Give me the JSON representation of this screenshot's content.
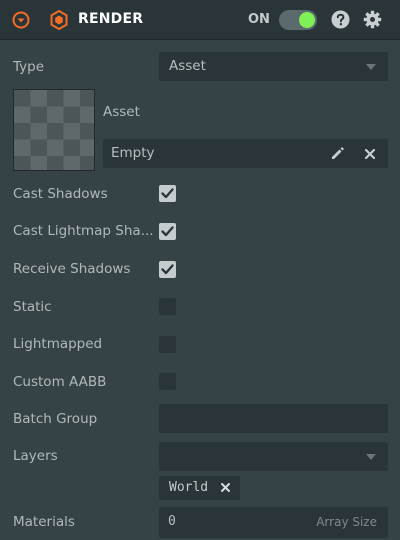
{
  "header": {
    "title": "RENDER",
    "enabled_label": "ON",
    "enabled": true,
    "accent_color": "#f66d25",
    "toggle_on_color": "#7ff057",
    "icons": [
      "collapse-icon",
      "render-component-icon",
      "help-icon",
      "gear-icon"
    ]
  },
  "fields": {
    "type": {
      "label": "Type",
      "value": "Asset"
    },
    "asset": {
      "label": "Asset",
      "value": "Empty"
    },
    "cast_shadows": {
      "label": "Cast Shadows",
      "checked": true
    },
    "cast_lightmap_shadows": {
      "label": "Cast Lightmap Sha...",
      "checked": true
    },
    "receive_shadows": {
      "label": "Receive Shadows",
      "checked": true
    },
    "static": {
      "label": "Static",
      "checked": false
    },
    "lightmapped": {
      "label": "Lightmapped",
      "checked": false
    },
    "custom_aabb": {
      "label": "Custom AABB",
      "checked": false
    },
    "batch_group": {
      "label": "Batch Group",
      "value": ""
    },
    "layers": {
      "label": "Layers",
      "value": "",
      "tags": [
        "World"
      ]
    },
    "materials": {
      "label": "Materials",
      "value": "0",
      "suffix": "Array Size"
    }
  }
}
